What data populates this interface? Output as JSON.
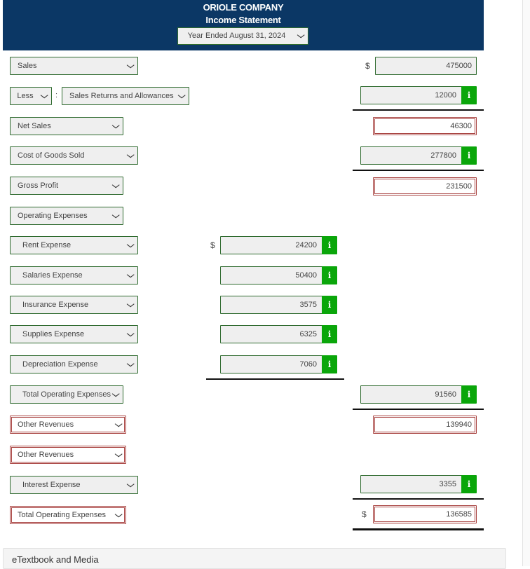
{
  "header": {
    "company": "ORIOLE COMPANY",
    "statement": "Income Statement",
    "period": "Year Ended August 31, 2024"
  },
  "currency_symbol": "$",
  "rows": {
    "sales": {
      "label": "Sales",
      "value": "475000"
    },
    "returns": {
      "operator": "Less",
      "separator": ":",
      "label": "Sales Returns and Allowances",
      "value": "12000"
    },
    "net_sales": {
      "label": "Net Sales",
      "value": "46300"
    },
    "cogs": {
      "label": "Cost of Goods Sold",
      "value": "277800"
    },
    "gross_profit": {
      "label": "Gross Profit",
      "value": "231500"
    },
    "opex_heading": {
      "label": "Operating Expenses"
    },
    "rent": {
      "label": "Rent Expense",
      "value": "24200"
    },
    "salaries": {
      "label": "Salaries Expense",
      "value": "50400"
    },
    "insurance": {
      "label": "Insurance Expense",
      "value": "3575"
    },
    "supplies": {
      "label": "Supplies Expense",
      "value": "6325"
    },
    "depreciation": {
      "label": "Depreciation Expense",
      "value": "7060"
    },
    "total_opex": {
      "label": "Total Operating Expenses",
      "value": "91560"
    },
    "other_rev_1": {
      "label": "Other Revenues",
      "value": "139940"
    },
    "other_rev_2": {
      "label": "Other Revenues"
    },
    "interest": {
      "label": "Interest Expense",
      "value": "3355"
    },
    "final_total": {
      "label": "Total Operating Expenses",
      "value": "136585"
    }
  },
  "info_icon_glyph": "i",
  "chevron_glyph": "⌄",
  "footer": {
    "label": "eTextbook and Media"
  },
  "colors": {
    "header_bg": "#0b3765",
    "field_border_ok": "#2f6b2f",
    "field_border_error": "#a94442",
    "info_button": "#0aa60a"
  }
}
